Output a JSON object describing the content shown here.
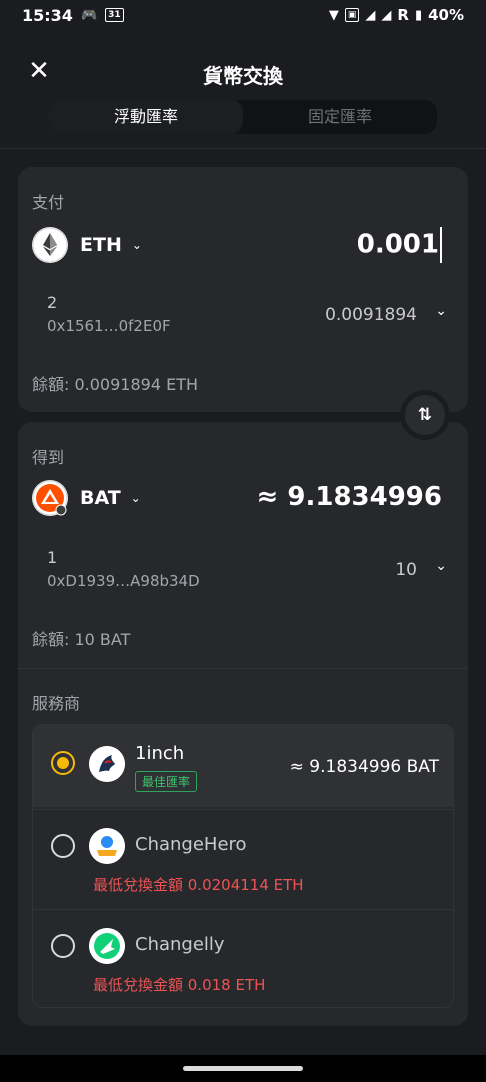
{
  "status_bar": {
    "time": "15:34",
    "calendar_day": "31",
    "carrier_r": "R",
    "battery": "40%"
  },
  "header": {
    "title": "貨幣交換"
  },
  "tabs": [
    {
      "label": "浮動匯率",
      "active": true
    },
    {
      "label": "固定匯率",
      "active": false
    }
  ],
  "pay": {
    "label": "支付",
    "token": "ETH",
    "amount": "0.001",
    "wallet_name": "2",
    "wallet_address": "0x1561…0f2E0F",
    "wallet_balance": "0.0091894",
    "balance_text": "餘額: 0.0091894 ETH"
  },
  "get": {
    "label": "得到",
    "token": "BAT",
    "amount": "≈ 9.1834996",
    "wallet_name": "1",
    "wallet_address": "0xD1939…A98b34D",
    "wallet_balance": "10",
    "balance_text": "餘額: 10 BAT"
  },
  "providers": {
    "label": "服務商",
    "items": [
      {
        "name": "1inch",
        "badge": "最佳匯率",
        "quote": "≈ 9.1834996 BAT",
        "selected": true
      },
      {
        "name": "ChangeHero",
        "min_text": "最低兌換金額 0.0204114 ETH",
        "selected": false
      },
      {
        "name": "Changelly",
        "min_text": "最低兌換金額 0.018 ETH",
        "selected": false
      }
    ]
  },
  "colors": {
    "background": "#1b1c1f",
    "card": "#27282c",
    "accent_radio": "#f5b90a",
    "badge_green": "#3ec46c",
    "warning_red": "#ec5454"
  }
}
